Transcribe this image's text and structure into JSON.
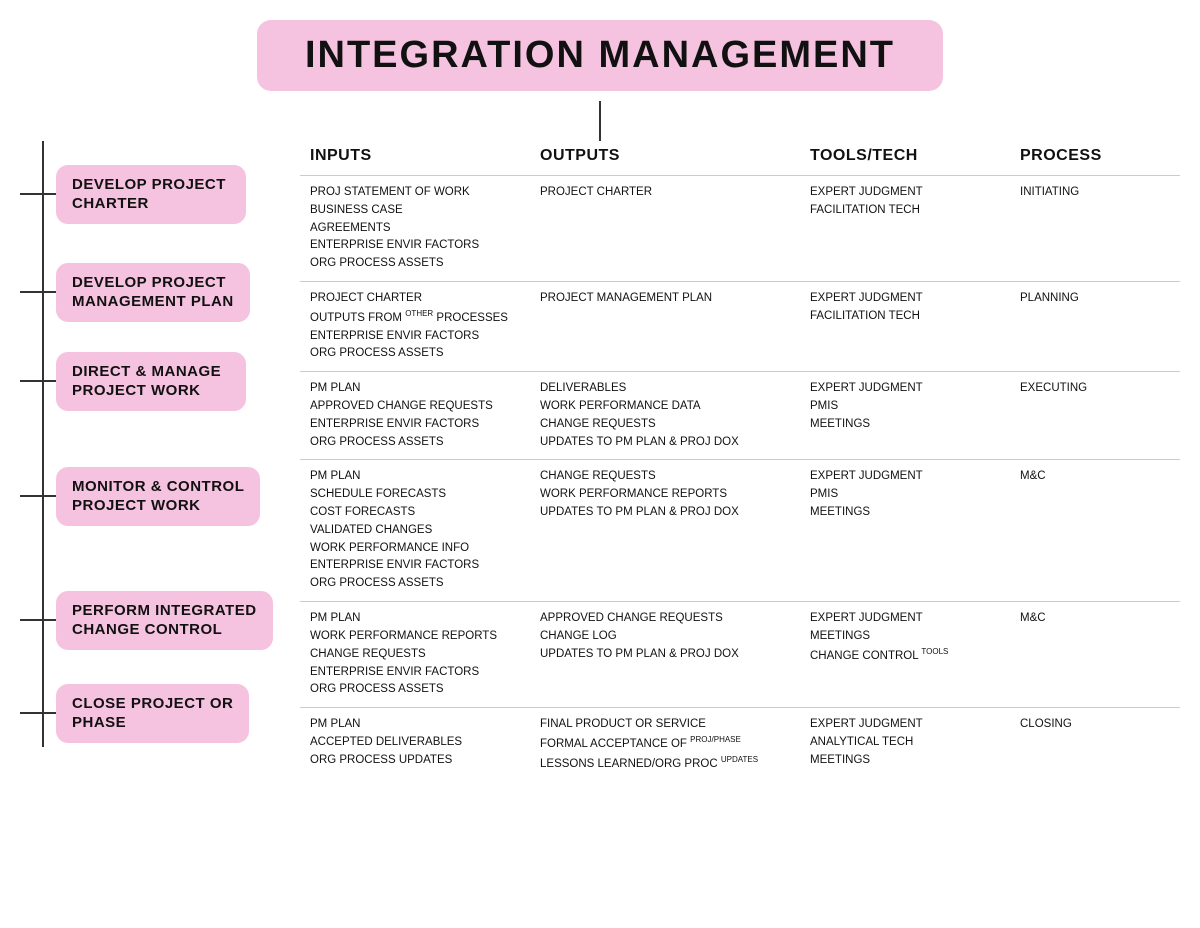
{
  "title": "INTEGRATION MANAGEMENT",
  "col_headers": [
    "INPUTS",
    "OUTPUTS",
    "TOOLS/TECH",
    "PROCESS"
  ],
  "processes": [
    {
      "label": "DEVELOP PROJECT\nCHARTER",
      "inputs": [
        "PROJ STATEMENT OF WORK",
        "BUSINESS CASE",
        "AGREEMENTS",
        "ENTERPRISE ENVIR FACTORS",
        "ORG PROCESS ASSETS"
      ],
      "outputs": [
        "PROJECT CHARTER"
      ],
      "tools": [
        "EXPERT JUDGMENT",
        "FACILITATION TECH"
      ],
      "process": "INITIATING"
    },
    {
      "label": "DEVELOP PROJECT\nMANAGEMENT PLAN",
      "inputs": [
        "PROJECT CHARTER",
        {
          "text": "OUTPUTS FROM ",
          "sup": "OTHER",
          "rest": " PROCESSES"
        },
        "ENTERPRISE ENVIR FACTORS",
        "ORG PROCESS ASSETS"
      ],
      "outputs": [
        "PROJECT MANAGEMENT PLAN"
      ],
      "tools": [
        "EXPERT JUDGMENT",
        "FACILITATION TECH"
      ],
      "process": "PLANNING"
    },
    {
      "label": "DIRECT & MANAGE\nPROJECT WORK",
      "inputs": [
        "PM PLAN",
        "APPROVED CHANGE REQUESTS",
        "ENTERPRISE ENVIR FACTORS",
        "ORG PROCESS ASSETS"
      ],
      "outputs": [
        "DELIVERABLES",
        "WORK PERFORMANCE DATA",
        "CHANGE REQUESTS",
        "UPDATES TO PM PLAN & PROJ DOX"
      ],
      "tools": [
        "EXPERT JUDGMENT",
        "PMIS",
        "MEETINGS"
      ],
      "process": "EXECUTING"
    },
    {
      "label": "MONITOR & CONTROL\nPROJECT WORK",
      "inputs": [
        "PM PLAN",
        "SCHEDULE FORECASTS",
        "COST FORECASTS",
        "VALIDATED CHANGES",
        "WORK PERFORMANCE INFO",
        "ENTERPRISE ENVIR FACTORS",
        "ORG PROCESS ASSETS"
      ],
      "outputs": [
        "CHANGE REQUESTS",
        "WORK PERFORMANCE REPORTS",
        "UPDATES TO PM PLAN & PROJ DOX"
      ],
      "tools": [
        "EXPERT JUDGMENT",
        "PMIS",
        "MEETINGS"
      ],
      "process": "M&C"
    },
    {
      "label": "PERFORM INTEGRATED\nCHANGE CONTROL",
      "inputs": [
        "PM PLAN",
        "WORK PERFORMANCE REPORTS",
        "CHANGE REQUESTS",
        "ENTERPRISE ENVIR FACTORS",
        "ORG PROCESS ASSETS"
      ],
      "outputs": [
        "APPROVED CHANGE REQUESTS",
        "CHANGE LOG",
        "UPDATES TO PM PLAN & PROJ DOX"
      ],
      "tools": [
        "EXPERT JUDGMENT",
        "MEETINGS",
        {
          "text": "CHANGE CONTROL ",
          "sup": "TOOLS"
        }
      ],
      "process": "M&C"
    },
    {
      "label": "CLOSE PROJECT OR\nPHASE",
      "inputs": [
        "PM PLAN",
        "ACCEPTED DELIVERABLES",
        "ORG PROCESS UPDATES"
      ],
      "outputs": [
        "FINAL PRODUCT OR SERVICE",
        {
          "text": "FORMAL ACCEPTANCE OF ",
          "sup": "PROJ/PHASE"
        },
        {
          "text": "LESSONS LEARNED/ORG PROC ",
          "sup": "UPDATES"
        }
      ],
      "tools": [
        "EXPERT JUDGMENT",
        "ANALYTICAL TECH",
        "MEETINGS"
      ],
      "process": "CLOSING"
    }
  ]
}
